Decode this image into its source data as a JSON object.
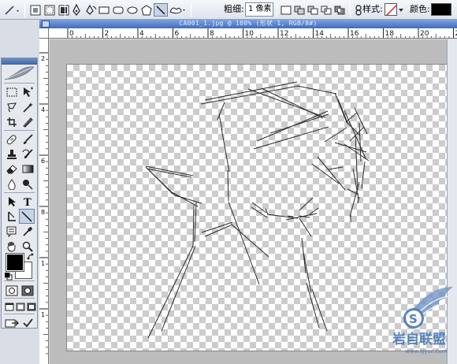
{
  "options_bar": {
    "weight_label": "粗细:",
    "weight_value": "1 像素",
    "style_label": "样式:",
    "color_label": "颜色:",
    "color": "#000000"
  },
  "document": {
    "title": "CA001_1.jpg @ 100% (形状 1, RGB/8#)",
    "hruler_numbers": [
      "0",
      "2",
      "4",
      "6",
      "8",
      "10",
      "12",
      "14",
      "16",
      "18",
      "20",
      "22"
    ],
    "vruler_numbers": [
      "2",
      "4",
      "6",
      "8",
      "1",
      "1"
    ]
  },
  "toolbox": {
    "foreground_color": "#000000",
    "background_color": "#ffffff",
    "tools": [
      "marquee-icon",
      "move-icon",
      "lasso-icon",
      "magic-wand-icon",
      "crop-icon",
      "slice-icon",
      "healing-brush-icon",
      "brush-icon",
      "clone-stamp-icon",
      "history-brush-icon",
      "eraser-icon",
      "gradient-icon",
      "blur-icon",
      "dodge-icon",
      "path-selection-icon",
      "type-icon",
      "pen-icon",
      "line-icon",
      "notes-icon",
      "eyedropper-icon",
      "hand-icon",
      "zoom-icon"
    ]
  },
  "watermark": {
    "text": "岩自联盟",
    "url": "www.sjyse.com"
  }
}
